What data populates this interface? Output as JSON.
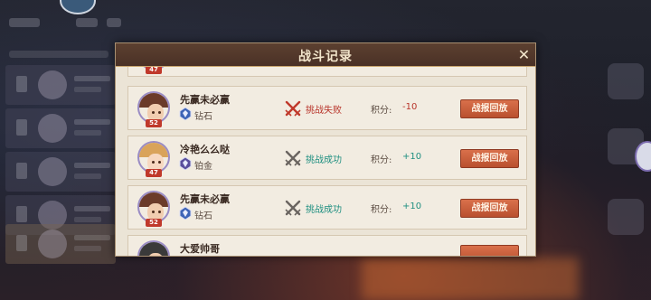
{
  "modal": {
    "title": "战斗记录",
    "close_symbol": "✕"
  },
  "colors": {
    "fail": "#b8342a",
    "success": "#1f8f80",
    "button": "#c85e3c",
    "header": "#55392b"
  },
  "records": [
    {
      "name": "",
      "level": "47",
      "tier": "",
      "result": "",
      "score_label": "",
      "score": "",
      "button": "",
      "partial": "top"
    },
    {
      "name": "先赢未必赢",
      "level": "52",
      "tier": "钻石",
      "tier_icon": "diamond-rank-icon",
      "result": "挑战失败",
      "result_state": "fail",
      "score_label": "积分:",
      "score": "-10",
      "button": "战报回放"
    },
    {
      "name": "冷艳么么哒",
      "level": "47",
      "tier": "铂金",
      "tier_icon": "platinum-rank-icon",
      "result": "挑战成功",
      "result_state": "success",
      "score_label": "积分:",
      "score": "+10",
      "button": "战报回放"
    },
    {
      "name": "先赢未必赢",
      "level": "52",
      "tier": "钻石",
      "tier_icon": "diamond-rank-icon",
      "result": "挑战成功",
      "result_state": "success",
      "score_label": "积分:",
      "score": "+10",
      "button": "战报回放"
    },
    {
      "name": "大爱帅哥",
      "level": "",
      "tier": "",
      "result": "",
      "score_label": "",
      "score": "",
      "button": "",
      "partial": "bottom"
    }
  ]
}
